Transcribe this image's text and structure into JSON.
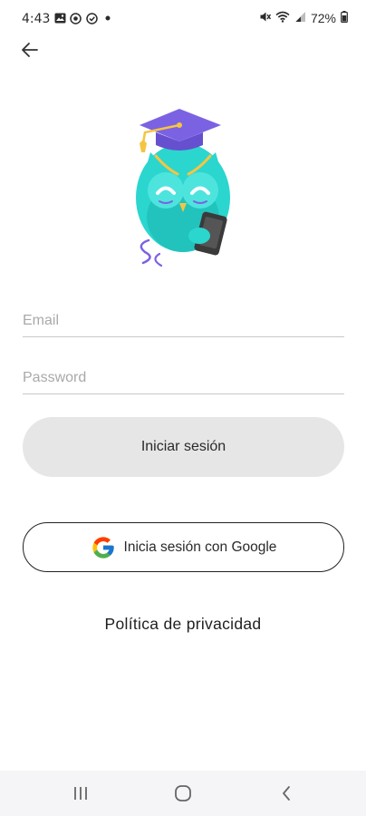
{
  "status_bar": {
    "time": "4:43",
    "battery": "72%",
    "notification_icons": [
      "gallery-icon",
      "notification-circle-icon",
      "notification-circle-icon",
      "dot-icon"
    ],
    "system_icons": [
      "mute-icon",
      "wifi-icon",
      "signal-icon",
      "battery-icon"
    ]
  },
  "header": {
    "back_icon": "arrow-left-icon"
  },
  "illustration": {
    "name": "owl-graduate-with-phone",
    "colors": {
      "body": "#2bd6cf",
      "cap": "#7b62e3",
      "tassel": "#f5c542",
      "phone": "#3a3a3a"
    }
  },
  "form": {
    "email_placeholder": "Email",
    "password_placeholder": "Password",
    "login_label": "Iniciar sesión",
    "google_label": "Inicia sesión con Google"
  },
  "footer": {
    "privacy_label": "Política de privacidad"
  },
  "nav_bar": {
    "items": [
      "recent-apps-icon",
      "home-icon",
      "back-icon"
    ]
  }
}
